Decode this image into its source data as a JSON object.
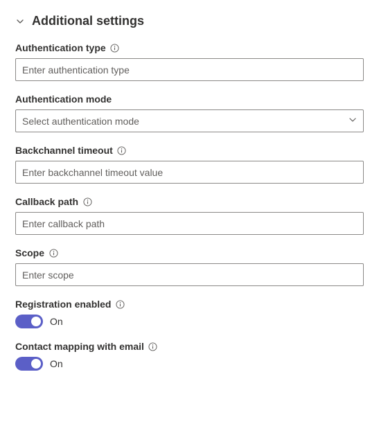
{
  "section": {
    "title": "Additional settings"
  },
  "fields": {
    "auth_type": {
      "label": "Authentication type",
      "placeholder": "Enter authentication type",
      "value": ""
    },
    "auth_mode": {
      "label": "Authentication mode",
      "placeholder": "Select authentication mode",
      "value": ""
    },
    "backchannel_timeout": {
      "label": "Backchannel timeout",
      "placeholder": "Enter backchannel timeout value",
      "value": ""
    },
    "callback_path": {
      "label": "Callback path",
      "placeholder": "Enter callback path",
      "value": ""
    },
    "scope": {
      "label": "Scope",
      "placeholder": "Enter scope",
      "value": ""
    },
    "registration_enabled": {
      "label": "Registration enabled",
      "state_label": "On",
      "value": true
    },
    "contact_mapping": {
      "label": "Contact mapping with email",
      "state_label": "On",
      "value": true
    }
  }
}
